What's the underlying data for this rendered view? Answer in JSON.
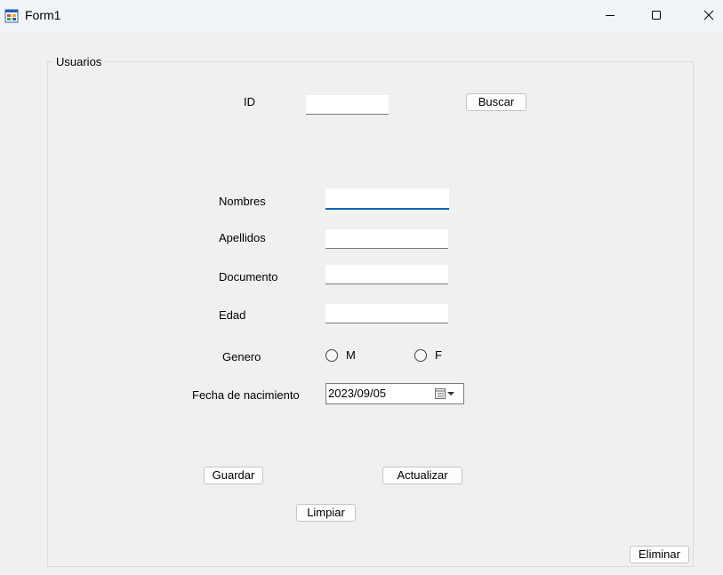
{
  "window": {
    "title": "Form1"
  },
  "group": {
    "title": "Usuarios"
  },
  "id_field": {
    "label": "ID",
    "value": ""
  },
  "buttons": {
    "buscar": "Buscar",
    "guardar": "Guardar",
    "actualizar": "Actualizar",
    "limpiar": "Limpiar",
    "eliminar": "Eliminar"
  },
  "fields": {
    "nombres": {
      "label": "Nombres",
      "value": ""
    },
    "apellidos": {
      "label": "Apellidos",
      "value": ""
    },
    "documento": {
      "label": "Documento",
      "value": ""
    },
    "edad": {
      "label": "Edad",
      "value": ""
    }
  },
  "genero": {
    "label": "Genero",
    "options": [
      "M",
      "F"
    ]
  },
  "fecha": {
    "label": "Fecha de nacimiento",
    "value": "2023/09/05"
  },
  "icons": {
    "app": "app-form-icon",
    "minimize": "minimize-icon",
    "maximize": "maximize-icon",
    "close": "close-icon",
    "calendar": "calendar-dropdown-icon"
  }
}
